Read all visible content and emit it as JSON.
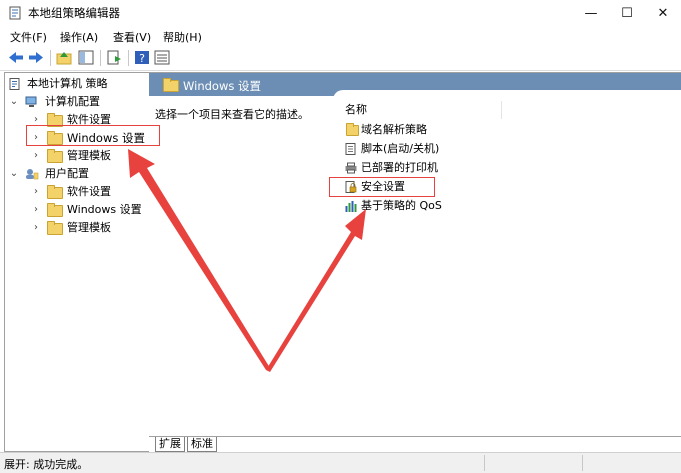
{
  "window": {
    "title": "本地组策略编辑器",
    "minimize_glyph": "—",
    "maximize_glyph": "☐",
    "close_glyph": "✕"
  },
  "menu": [
    "文件(F)",
    "操作(A)",
    "查看(V)",
    "帮助(H)"
  ],
  "tree": {
    "root": "本地计算机 策略",
    "computer_config": "计算机配置",
    "computer_children": [
      "软件设置",
      "Windows 设置",
      "管理模板"
    ],
    "user_config": "用户配置",
    "user_children": [
      "软件设置",
      "Windows 设置",
      "管理模板"
    ]
  },
  "right_pane": {
    "header": "Windows 设置",
    "description": "选择一个项目来查看它的描述。",
    "column_name": "名称",
    "items": [
      "域名解析策略",
      "脚本(启动/关机)",
      "已部署的打印机",
      "安全设置",
      "基于策略的 QoS"
    ]
  },
  "tabs": [
    "扩展",
    "标准"
  ],
  "status": "展开: 成功完成。",
  "colors": {
    "header_bg": "#6d8eb4",
    "highlight": "#e8423e",
    "folder": "#f3d26a"
  }
}
